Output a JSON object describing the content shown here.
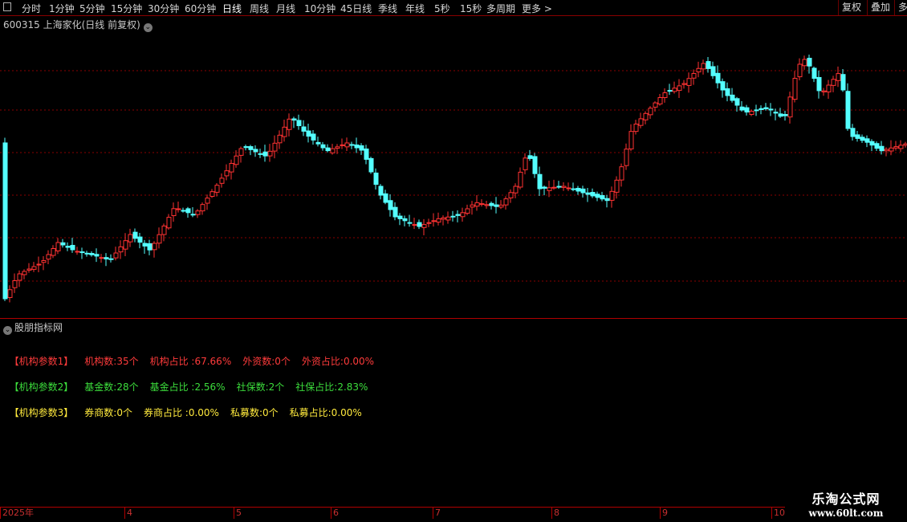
{
  "toolbar": {
    "periods": [
      "分时",
      "1分钟",
      "5分钟",
      "15分钟",
      "30分钟",
      "60分钟",
      "日线",
      "周线",
      "月线",
      "10分钟",
      "45日线",
      "季线",
      "年线",
      "5秒",
      "15秒",
      "多周期",
      "更多 >"
    ],
    "active_period": "日线",
    "right_buttons": [
      "复权",
      "叠加",
      "多"
    ]
  },
  "chart": {
    "title": "600315 上海家化(日线 前复权)",
    "up_color": "#ff3232",
    "down_color": "#54ffff",
    "grid_color": "#8a0000"
  },
  "indicator": {
    "title": "股朋指标网",
    "rows": [
      {
        "label": "【机构参数1】",
        "items": [
          "机构数:35个",
          "机构占比 :67.66%",
          "外资数:0个",
          "外资占比:0.00%"
        ],
        "color": "#ff3b3b"
      },
      {
        "label": "【机构参数2】",
        "items": [
          "基金数:28个",
          "基金占比 :2.56%",
          "社保数:2个",
          "社保占比:2.83%"
        ],
        "color": "#3cde3c"
      },
      {
        "label": "【机构参数3】",
        "items": [
          "券商数:0个",
          "券商占比 :0.00%",
          "私募数:0个",
          "私募占比:0.00%"
        ],
        "color": "#ffea3d"
      }
    ]
  },
  "time_axis": [
    "2025年",
    "4",
    "5",
    "6",
    "7",
    "8",
    "9",
    "10"
  ],
  "watermark": {
    "title": "乐淘公式网",
    "url": "www.60lt.com"
  }
}
